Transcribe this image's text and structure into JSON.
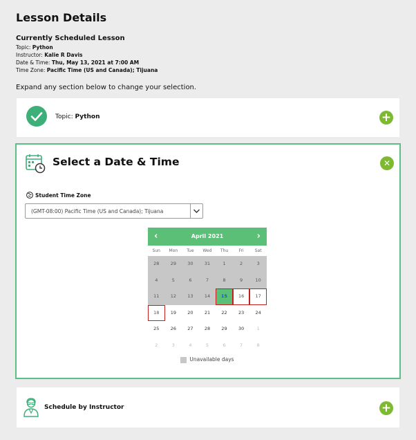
{
  "page": {
    "title": "Lesson Details"
  },
  "scheduled": {
    "heading": "Currently Scheduled Lesson",
    "topic_label": "Topic:",
    "topic_value": "Python",
    "instructor_label": "Instructor:",
    "instructor_value": "Kalie R Davis",
    "datetime_label": "Date & Time:",
    "datetime_value": "Thu, May 13, 2021 at 7:00 AM",
    "timezone_label": "Time Zone:",
    "timezone_value": "Pacific Time (US and Canada); Tijuana"
  },
  "expand_note": "Expand any section below to change your selection.",
  "topic_section": {
    "label": "Topic:",
    "value": "Python",
    "toggle": "+"
  },
  "datetime_section": {
    "title": "Select a Date & Time",
    "close": "✕",
    "tz_label": "Student Time Zone",
    "tz_selected": "(GMT-08:00) Pacific Time (US and Canada); Tijuana"
  },
  "calendar": {
    "month": "April 2021",
    "prev": "‹",
    "next": "›",
    "dows": [
      "Sun",
      "Mon",
      "Tue",
      "Wed",
      "Thu",
      "Fri",
      "Sat"
    ],
    "days": [
      {
        "d": "28",
        "s": "unavail"
      },
      {
        "d": "29",
        "s": "unavail"
      },
      {
        "d": "30",
        "s": "unavail"
      },
      {
        "d": "31",
        "s": "unavail"
      },
      {
        "d": "1",
        "s": "unavail"
      },
      {
        "d": "2",
        "s": "unavail"
      },
      {
        "d": "3",
        "s": "unavail"
      },
      {
        "d": "4",
        "s": "unavail"
      },
      {
        "d": "5",
        "s": "unavail"
      },
      {
        "d": "6",
        "s": "unavail"
      },
      {
        "d": "7",
        "s": "unavail"
      },
      {
        "d": "8",
        "s": "unavail"
      },
      {
        "d": "9",
        "s": "unavail"
      },
      {
        "d": "10",
        "s": "unavail"
      },
      {
        "d": "11",
        "s": "unavail"
      },
      {
        "d": "12",
        "s": "unavail"
      },
      {
        "d": "13",
        "s": "unavail"
      },
      {
        "d": "14",
        "s": "unavail"
      },
      {
        "d": "15",
        "s": "selected"
      },
      {
        "d": "16",
        "s": "outlined"
      },
      {
        "d": "17",
        "s": "outlined"
      },
      {
        "d": "18",
        "s": "outlined"
      },
      {
        "d": "19",
        "s": "avail"
      },
      {
        "d": "20",
        "s": "avail"
      },
      {
        "d": "21",
        "s": "avail"
      },
      {
        "d": "22",
        "s": "avail"
      },
      {
        "d": "23",
        "s": "avail"
      },
      {
        "d": "24",
        "s": "avail"
      },
      {
        "d": "25",
        "s": "avail"
      },
      {
        "d": "26",
        "s": "avail"
      },
      {
        "d": "27",
        "s": "avail"
      },
      {
        "d": "28",
        "s": "avail"
      },
      {
        "d": "29",
        "s": "avail"
      },
      {
        "d": "30",
        "s": "avail"
      },
      {
        "d": "1",
        "s": "other"
      },
      {
        "d": "2",
        "s": "other"
      },
      {
        "d": "3",
        "s": "other"
      },
      {
        "d": "4",
        "s": "other"
      },
      {
        "d": "5",
        "s": "other"
      },
      {
        "d": "6",
        "s": "other"
      },
      {
        "d": "7",
        "s": "other"
      },
      {
        "d": "8",
        "s": "other"
      }
    ],
    "legend": "Unavailable days"
  },
  "instructor_section": {
    "label": "Schedule by Instructor",
    "toggle": "+"
  },
  "colors": {
    "accent": "#7dba2f",
    "calendar_green": "#5cbf78",
    "outline_red": "#c41e1e",
    "unavailable": "#c7c7c7"
  },
  "icons": [
    "check-icon",
    "plus-icon",
    "calendar-clock-icon",
    "close-icon",
    "globe-icon",
    "chevron-down-icon",
    "instructor-icon"
  ]
}
